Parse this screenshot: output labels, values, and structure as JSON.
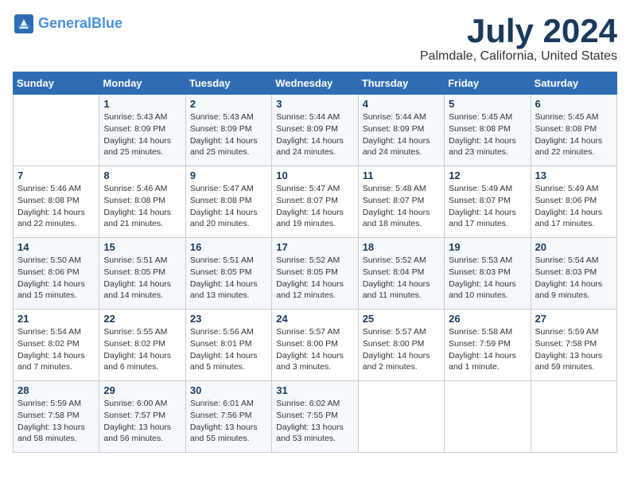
{
  "logo": {
    "line1": "General",
    "line2": "Blue"
  },
  "title": "July 2024",
  "location": "Palmdale, California, United States",
  "days_of_week": [
    "Sunday",
    "Monday",
    "Tuesday",
    "Wednesday",
    "Thursday",
    "Friday",
    "Saturday"
  ],
  "weeks": [
    [
      {
        "day": "",
        "sunrise": "",
        "sunset": "",
        "daylight": ""
      },
      {
        "day": "1",
        "sunrise": "Sunrise: 5:43 AM",
        "sunset": "Sunset: 8:09 PM",
        "daylight": "Daylight: 14 hours and 25 minutes."
      },
      {
        "day": "2",
        "sunrise": "Sunrise: 5:43 AM",
        "sunset": "Sunset: 8:09 PM",
        "daylight": "Daylight: 14 hours and 25 minutes."
      },
      {
        "day": "3",
        "sunrise": "Sunrise: 5:44 AM",
        "sunset": "Sunset: 8:09 PM",
        "daylight": "Daylight: 14 hours and 24 minutes."
      },
      {
        "day": "4",
        "sunrise": "Sunrise: 5:44 AM",
        "sunset": "Sunset: 8:09 PM",
        "daylight": "Daylight: 14 hours and 24 minutes."
      },
      {
        "day": "5",
        "sunrise": "Sunrise: 5:45 AM",
        "sunset": "Sunset: 8:08 PM",
        "daylight": "Daylight: 14 hours and 23 minutes."
      },
      {
        "day": "6",
        "sunrise": "Sunrise: 5:45 AM",
        "sunset": "Sunset: 8:08 PM",
        "daylight": "Daylight: 14 hours and 22 minutes."
      }
    ],
    [
      {
        "day": "7",
        "sunrise": "Sunrise: 5:46 AM",
        "sunset": "Sunset: 8:08 PM",
        "daylight": "Daylight: 14 hours and 22 minutes."
      },
      {
        "day": "8",
        "sunrise": "Sunrise: 5:46 AM",
        "sunset": "Sunset: 8:08 PM",
        "daylight": "Daylight: 14 hours and 21 minutes."
      },
      {
        "day": "9",
        "sunrise": "Sunrise: 5:47 AM",
        "sunset": "Sunset: 8:08 PM",
        "daylight": "Daylight: 14 hours and 20 minutes."
      },
      {
        "day": "10",
        "sunrise": "Sunrise: 5:47 AM",
        "sunset": "Sunset: 8:07 PM",
        "daylight": "Daylight: 14 hours and 19 minutes."
      },
      {
        "day": "11",
        "sunrise": "Sunrise: 5:48 AM",
        "sunset": "Sunset: 8:07 PM",
        "daylight": "Daylight: 14 hours and 18 minutes."
      },
      {
        "day": "12",
        "sunrise": "Sunrise: 5:49 AM",
        "sunset": "Sunset: 8:07 PM",
        "daylight": "Daylight: 14 hours and 17 minutes."
      },
      {
        "day": "13",
        "sunrise": "Sunrise: 5:49 AM",
        "sunset": "Sunset: 8:06 PM",
        "daylight": "Daylight: 14 hours and 17 minutes."
      }
    ],
    [
      {
        "day": "14",
        "sunrise": "Sunrise: 5:50 AM",
        "sunset": "Sunset: 8:06 PM",
        "daylight": "Daylight: 14 hours and 15 minutes."
      },
      {
        "day": "15",
        "sunrise": "Sunrise: 5:51 AM",
        "sunset": "Sunset: 8:05 PM",
        "daylight": "Daylight: 14 hours and 14 minutes."
      },
      {
        "day": "16",
        "sunrise": "Sunrise: 5:51 AM",
        "sunset": "Sunset: 8:05 PM",
        "daylight": "Daylight: 14 hours and 13 minutes."
      },
      {
        "day": "17",
        "sunrise": "Sunrise: 5:52 AM",
        "sunset": "Sunset: 8:05 PM",
        "daylight": "Daylight: 14 hours and 12 minutes."
      },
      {
        "day": "18",
        "sunrise": "Sunrise: 5:52 AM",
        "sunset": "Sunset: 8:04 PM",
        "daylight": "Daylight: 14 hours and 11 minutes."
      },
      {
        "day": "19",
        "sunrise": "Sunrise: 5:53 AM",
        "sunset": "Sunset: 8:03 PM",
        "daylight": "Daylight: 14 hours and 10 minutes."
      },
      {
        "day": "20",
        "sunrise": "Sunrise: 5:54 AM",
        "sunset": "Sunset: 8:03 PM",
        "daylight": "Daylight: 14 hours and 9 minutes."
      }
    ],
    [
      {
        "day": "21",
        "sunrise": "Sunrise: 5:54 AM",
        "sunset": "Sunset: 8:02 PM",
        "daylight": "Daylight: 14 hours and 7 minutes."
      },
      {
        "day": "22",
        "sunrise": "Sunrise: 5:55 AM",
        "sunset": "Sunset: 8:02 PM",
        "daylight": "Daylight: 14 hours and 6 minutes."
      },
      {
        "day": "23",
        "sunrise": "Sunrise: 5:56 AM",
        "sunset": "Sunset: 8:01 PM",
        "daylight": "Daylight: 14 hours and 5 minutes."
      },
      {
        "day": "24",
        "sunrise": "Sunrise: 5:57 AM",
        "sunset": "Sunset: 8:00 PM",
        "daylight": "Daylight: 14 hours and 3 minutes."
      },
      {
        "day": "25",
        "sunrise": "Sunrise: 5:57 AM",
        "sunset": "Sunset: 8:00 PM",
        "daylight": "Daylight: 14 hours and 2 minutes."
      },
      {
        "day": "26",
        "sunrise": "Sunrise: 5:58 AM",
        "sunset": "Sunset: 7:59 PM",
        "daylight": "Daylight: 14 hours and 1 minute."
      },
      {
        "day": "27",
        "sunrise": "Sunrise: 5:59 AM",
        "sunset": "Sunset: 7:58 PM",
        "daylight": "Daylight: 13 hours and 59 minutes."
      }
    ],
    [
      {
        "day": "28",
        "sunrise": "Sunrise: 5:59 AM",
        "sunset": "Sunset: 7:58 PM",
        "daylight": "Daylight: 13 hours and 58 minutes."
      },
      {
        "day": "29",
        "sunrise": "Sunrise: 6:00 AM",
        "sunset": "Sunset: 7:57 PM",
        "daylight": "Daylight: 13 hours and 56 minutes."
      },
      {
        "day": "30",
        "sunrise": "Sunrise: 6:01 AM",
        "sunset": "Sunset: 7:56 PM",
        "daylight": "Daylight: 13 hours and 55 minutes."
      },
      {
        "day": "31",
        "sunrise": "Sunrise: 6:02 AM",
        "sunset": "Sunset: 7:55 PM",
        "daylight": "Daylight: 13 hours and 53 minutes."
      },
      {
        "day": "",
        "sunrise": "",
        "sunset": "",
        "daylight": ""
      },
      {
        "day": "",
        "sunrise": "",
        "sunset": "",
        "daylight": ""
      },
      {
        "day": "",
        "sunrise": "",
        "sunset": "",
        "daylight": ""
      }
    ]
  ]
}
